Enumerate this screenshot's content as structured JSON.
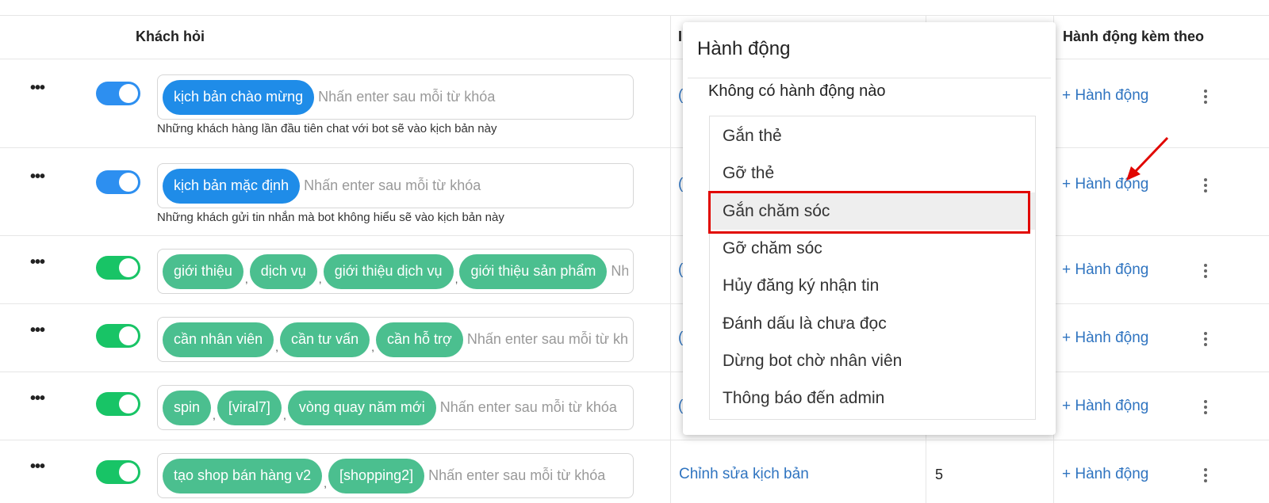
{
  "header": {
    "col_question": "Khách hỏi",
    "col_partial": "I",
    "col_followup": "Hành động kèm theo"
  },
  "keyword_placeholder": "Nhấn enter sau mỗi từ khóa",
  "partial_placeholder": "Nhấ",
  "rows": [
    {
      "toggle_color": "blue",
      "tags": [
        "kịch bản chào mừng"
      ],
      "description": "Những khách hàng lần đầu tiên chat với bot sẽ vào kịch bản này",
      "partial_link": "(",
      "action": "+ Hành động"
    },
    {
      "toggle_color": "blue",
      "tags": [
        "kịch bản mặc định"
      ],
      "description": "Những khách gửi tin nhắn mà bot không hiểu sẽ vào kịch bản này",
      "partial_link": "(",
      "action": "+ Hành động"
    },
    {
      "toggle_color": "green",
      "tags": [
        "giới thiệu",
        "dịch vụ",
        "giới thiệu dịch vụ",
        "giới thiệu sản phẩm"
      ],
      "partial_link": "(",
      "action": "+ Hành động"
    },
    {
      "toggle_color": "green",
      "tags": [
        "cần nhân viên",
        "cần tư vấn",
        "cần hỗ trợ"
      ],
      "partial_link": "(",
      "action": "+ Hành động"
    },
    {
      "toggle_color": "green",
      "tags": [
        "spin",
        "[viral7]",
        "vòng quay năm mới"
      ],
      "partial_link": "(",
      "action": "+ Hành động"
    },
    {
      "toggle_color": "green",
      "tags": [
        "tạo shop bán hàng v2",
        "[shopping2]"
      ],
      "edit_link": "Chỉnh sửa kịch bản",
      "count": "5",
      "action": "+ Hành động"
    }
  ],
  "dropdown": {
    "title": "Hành động",
    "none_label": "Không có hành động nào",
    "items": [
      "Gắn thẻ",
      "Gỡ thẻ",
      "Gắn chăm sóc",
      "Gỡ chăm sóc",
      "Hủy đăng ký nhận tin",
      "Đánh dấu là chưa đọc",
      "Dừng bot chờ nhân viên",
      "Thông báo đến admin"
    ],
    "active_item": "Gắn chăm sóc"
  },
  "colors": {
    "blue_tag": "#1f8ce8",
    "green_tag": "#4bbf8f",
    "link": "#2f74c0",
    "highlight": "#e10600"
  }
}
